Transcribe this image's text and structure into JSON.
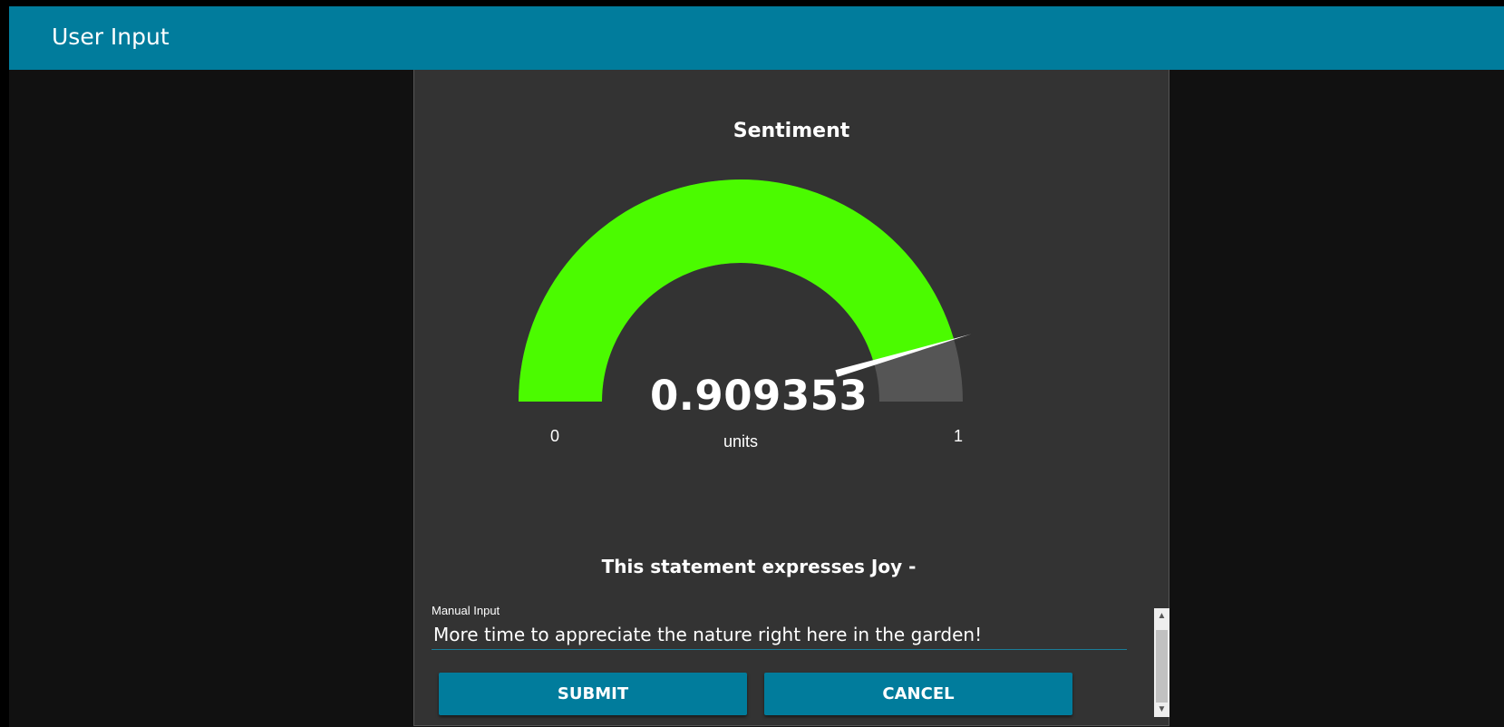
{
  "header": {
    "title": "User Input"
  },
  "gauge": {
    "title": "Sentiment",
    "value": 0.909353,
    "value_text": "0.909353",
    "units": "units",
    "min": 0,
    "max": 1,
    "min_label": "0",
    "max_label": "1",
    "fill_color": "#4BFB00",
    "track_color": "#555555",
    "needle_color": "#FFFFFF"
  },
  "statement": "This statement expresses Joy -",
  "form": {
    "label": "Manual Input",
    "value": "More time to appreciate the nature right here in the garden!",
    "submit_label": "SUBMIT",
    "cancel_label": "CANCEL"
  },
  "colors": {
    "accent": "#017C9C",
    "panel": "#333333",
    "background": "#111111"
  }
}
